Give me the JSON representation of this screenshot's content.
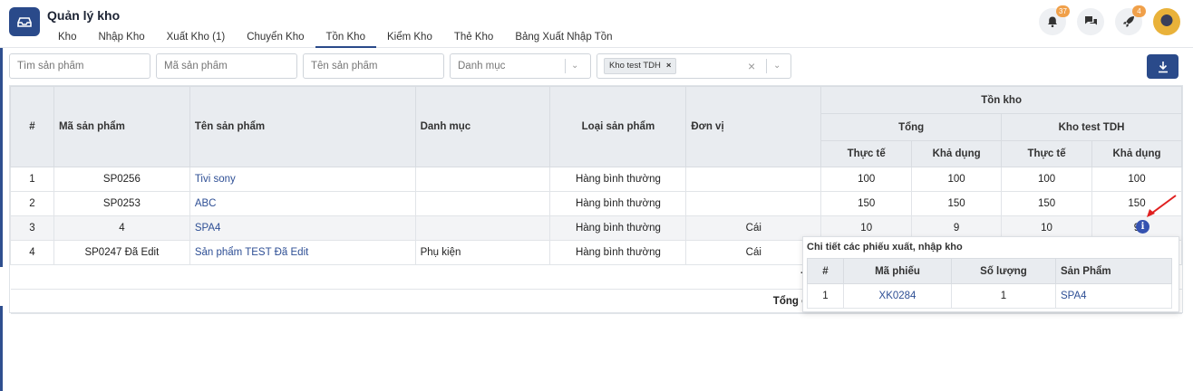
{
  "app": {
    "title": "Quản lý kho"
  },
  "tabs": [
    {
      "label": "Kho"
    },
    {
      "label": "Nhập Kho"
    },
    {
      "label": "Xuất Kho (1)"
    },
    {
      "label": "Chuyển Kho"
    },
    {
      "label": "Tồn Kho",
      "active": true
    },
    {
      "label": "Kiểm Kho"
    },
    {
      "label": "Thẻ Kho"
    },
    {
      "label": "Bảng Xuất Nhập Tồn"
    }
  ],
  "header_badges": {
    "notifications": "37",
    "rocket": "4"
  },
  "filters": {
    "search_placeholder": "Tìm sản phẩm",
    "code_placeholder": "Mã sản phẩm",
    "name_placeholder": "Tên sản phẩm",
    "category_placeholder": "Danh mục",
    "warehouse_tag": "Kho test TDH"
  },
  "table": {
    "headers": {
      "index": "#",
      "code": "Mã sản phẩm",
      "name": "Tên sản phẩm",
      "category": "Danh mục",
      "type": "Loại sản phẩm",
      "unit": "Đơn vị",
      "stock": "Tồn kho",
      "total": "Tổng",
      "warehouse": "Kho test TDH",
      "actual": "Thực tế",
      "available": "Khả dụng"
    },
    "rows": [
      {
        "idx": "1",
        "code": "SP0256",
        "name": "Tivi sony",
        "category": "",
        "type": "Hàng bình thường",
        "unit": "",
        "t_actual": "100",
        "t_avail": "100",
        "w_actual": "100",
        "w_avail": "100"
      },
      {
        "idx": "2",
        "code": "SP0253",
        "name": "ABC",
        "category": "",
        "type": "Hàng bình thường",
        "unit": "",
        "t_actual": "150",
        "t_avail": "150",
        "w_actual": "150",
        "w_avail": "150"
      },
      {
        "idx": "3",
        "code": "4",
        "name": "SPA4",
        "category": "",
        "type": "Hàng bình thường",
        "unit": "Cái",
        "t_actual": "10",
        "t_avail": "9",
        "w_actual": "10",
        "w_avail": "9"
      },
      {
        "idx": "4",
        "code": "SP0247 Đã Edit",
        "name": "Sản phẩm TEST Đã Edit",
        "category": "Phụ kiện",
        "type": "Hàng bình thường",
        "unit": "Cái",
        "t_actual": "",
        "t_avail": "",
        "w_actual": "",
        "w_avail": ""
      }
    ],
    "summary": [
      "T",
      "Tổng c"
    ]
  },
  "popover": {
    "title": "Chi tiết các phiếu xuất, nhập kho",
    "headers": [
      "#",
      "Mã phiếu",
      "Số lượng",
      "Sản Phẩm"
    ],
    "rows": [
      {
        "idx": "1",
        "code": "XK0284",
        "qty": "1",
        "product": "SPA4"
      }
    ]
  }
}
